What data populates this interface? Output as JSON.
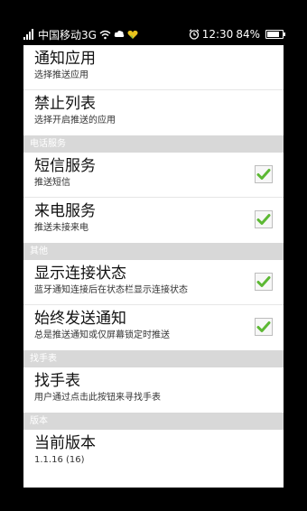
{
  "status_bar": {
    "carrier": "中国移动3G",
    "time": "12:30",
    "battery": "84%",
    "battery_level": 0.84
  },
  "items": [
    {
      "title": "通知应用",
      "summary": "选择推送应用"
    },
    {
      "title": "禁止列表",
      "summary": "选择开启推送的应用"
    }
  ],
  "sections": {
    "phone": {
      "header": "电话服务",
      "items": [
        {
          "title": "短信服务",
          "summary": "推送短信",
          "checked": true
        },
        {
          "title": "来电服务",
          "summary": "推送未接来电",
          "checked": true
        }
      ]
    },
    "other": {
      "header": "其他",
      "items": [
        {
          "title": "显示连接状态",
          "summary": "蓝牙通知连接后在状态栏显示连接状态",
          "checked": true
        },
        {
          "title": "始终发送通知",
          "summary": "总是推送通知或仅屏幕锁定时推送",
          "checked": true
        }
      ]
    },
    "find": {
      "header": "找手表",
      "items": [
        {
          "title": "找手表",
          "summary": "用户通过点击此按钮来寻找手表"
        }
      ]
    },
    "version": {
      "header": "版本",
      "items": [
        {
          "title": "当前版本",
          "summary": "1.1.16 (16)"
        }
      ]
    }
  },
  "colors": {
    "checkmark": "#5cb833",
    "section_bg": "#d8d8d8"
  },
  "icons": [
    "signal-icon",
    "wifi-icon",
    "cloud-icon",
    "heart-icon",
    "alarm-icon",
    "battery-icon",
    "checkmark-icon"
  ]
}
